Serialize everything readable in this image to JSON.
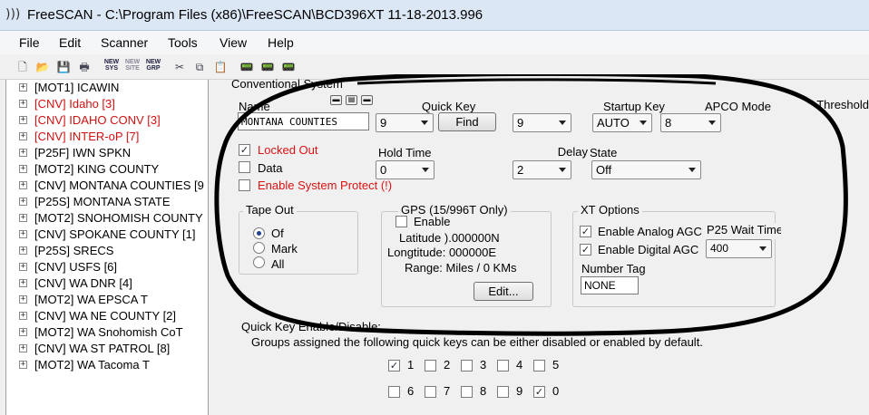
{
  "window": {
    "title": "FreeSCAN - C:\\Program Files (x86)\\FreeSCAN\\BCD396XT 11-18-2013.996"
  },
  "menu": [
    "File",
    "Edit",
    "Scanner",
    "Tools",
    "View",
    "Help"
  ],
  "toolbar": {
    "new_sys": [
      "NEW",
      "SYS"
    ],
    "new_site": [
      "NEW",
      "SITE"
    ],
    "new_grp": [
      "NEW",
      "GRP"
    ]
  },
  "tree": [
    {
      "label": "[MOT1] ICAWIN",
      "color": "#000000"
    },
    {
      "label": "[CNV] Idaho [3]",
      "color": "#d11111"
    },
    {
      "label": "[CNV] IDAHO CONV [3]",
      "color": "#d11111"
    },
    {
      "label": "[CNV]    INTER-oP [7]",
      "color": "#d11111"
    },
    {
      "label": "[P25F]     IWN SPKN",
      "color": "#000000"
    },
    {
      "label": "[MOT2]     KING COUNTY",
      "color": "#000000"
    },
    {
      "label": "[CNV] MONTANA COUNTIES [9",
      "color": "#000000"
    },
    {
      "label": "[P25S]  MONTANA STATE",
      "color": "#000000"
    },
    {
      "label": "[MOT2] SNOHOMISH COUNTY",
      "color": "#000000"
    },
    {
      "label": "[CNV] SPOKANE COUNTY [1]",
      "color": "#000000"
    },
    {
      "label": "[P25S]      SRECS",
      "color": "#000000"
    },
    {
      "label": "[CNV]       USFS [6]",
      "color": "#000000"
    },
    {
      "label": "[CNV]       WA DNR [4]",
      "color": "#000000"
    },
    {
      "label": "[MOT2] WA EPSCA T",
      "color": "#000000"
    },
    {
      "label": "[CNV]    WA NE COUNTY [2]",
      "color": "#000000"
    },
    {
      "label": "[MOT2] WA Snohomish CoT",
      "color": "#000000"
    },
    {
      "label": "[CNV] WA ST PATROL [8]",
      "color": "#000000"
    },
    {
      "label": "[MOT2] WA Tacoma T",
      "color": "#000000"
    }
  ],
  "panel": {
    "section_title": "Conventional System",
    "name_label": "Name",
    "name_value": "MONTANA COUNTIES",
    "quick_key_label": "Quick Key",
    "quick_key_value": "9",
    "find_button": "Find",
    "quick_key2_value": "9",
    "startup_key_label": "Startup Key",
    "startup_auto_value": "AUTO",
    "startup_key_value": "8",
    "apco_label": "APCO Mode",
    "threshold_label": "Threshold",
    "locked_out_label": "Locked Out",
    "locked_out_checked": "✓",
    "data_label": "Data",
    "protect_label": "Enable System Protect (!)",
    "hold_time_label": "Hold Time",
    "hold_time_value": "0",
    "delay_label": "Delay",
    "delay_value": "2",
    "state_label": "State",
    "state_value": "Off",
    "tape_out": {
      "title": "Tape Out",
      "options": [
        "Of",
        "Mark",
        "All"
      ]
    },
    "gps": {
      "title": "GPS (15/996T Only)",
      "enable_label": "Enable",
      "latitude": "Latitude ).000000N",
      "longitude": "Longtitude: 000000E",
      "range": "Range: Miles / 0 KMs",
      "edit_button": "Edit..."
    },
    "xt": {
      "title": "XT  Options",
      "analog_label": "Enable Analog AGC",
      "analog_checked": "✓",
      "digital_label": "Enable Digital AGC",
      "digital_checked": "✓",
      "p25_wait_label": "P25 Wait Time",
      "p25_wait_value": "400",
      "number_tag_label": "Number Tag",
      "number_tag_value": "NONE"
    },
    "qk_title": "Quick Key Enable/Disable:",
    "qk_desc": "Groups assigned the following quick keys can be either disabled or enabled by default.",
    "qk_row1": [
      {
        "n": "1",
        "c": "✓"
      },
      {
        "n": "2",
        "c": ""
      },
      {
        "n": "3",
        "c": ""
      },
      {
        "n": "4",
        "c": ""
      },
      {
        "n": "5",
        "c": ""
      }
    ],
    "qk_row2": [
      {
        "n": "6",
        "c": ""
      },
      {
        "n": "7",
        "c": ""
      },
      {
        "n": "8",
        "c": ""
      },
      {
        "n": "9",
        "c": ""
      },
      {
        "n": "0",
        "c": "✓"
      }
    ]
  }
}
